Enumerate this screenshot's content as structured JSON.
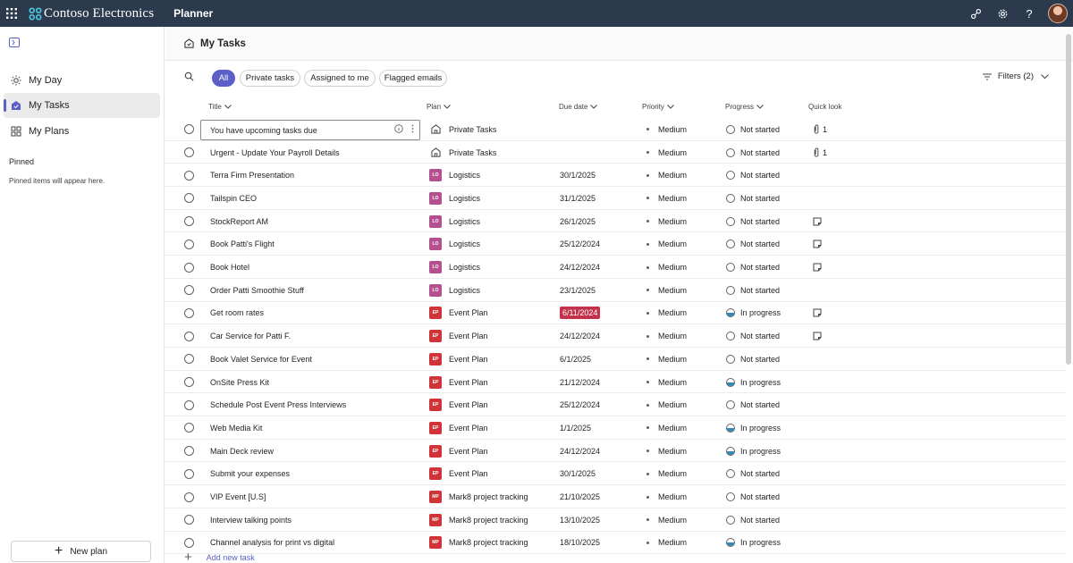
{
  "topbar": {
    "org_name": "Contoso Electronics",
    "app_name": "Planner",
    "bg_color": "#2b3a4d"
  },
  "sidebar": {
    "nav": [
      {
        "label": "My Day",
        "icon": "sun-icon"
      },
      {
        "label": "My Tasks",
        "icon": "my-tasks-icon",
        "active": true
      },
      {
        "label": "My Plans",
        "icon": "grid-icon"
      }
    ],
    "pinned_header": "Pinned",
    "pinned_empty": "Pinned items will appear here.",
    "new_plan_label": "New plan"
  },
  "header": {
    "title": "My Tasks"
  },
  "filters": {
    "pills": [
      "All",
      "Private tasks",
      "Assigned to me",
      "Flagged emails"
    ],
    "active_pill": "All",
    "filters_label": "Filters (2)"
  },
  "columns": {
    "title": "Title",
    "plan": "Plan",
    "due": "Due date",
    "priority": "Priority",
    "progress": "Progress",
    "quick_look": "Quick look"
  },
  "accent_color": "#5b5fc7",
  "plans": {
    "LO": {
      "color": "#b4508f"
    },
    "EP": {
      "color": "#d13438"
    },
    "MP": {
      "color": "#d13438"
    }
  },
  "tasks": [
    {
      "title": "You have upcoming tasks due",
      "plan": "Private Tasks",
      "plan_type": "home",
      "due": "",
      "priority": "Medium",
      "progress": "Not started",
      "quick_look": "attachment",
      "ql_count": "1",
      "selected": true
    },
    {
      "title": "Urgent - Update Your Payroll Details",
      "plan": "Private Tasks",
      "plan_type": "home",
      "due": "",
      "priority": "Medium",
      "progress": "Not started",
      "quick_look": "attachment",
      "ql_count": "1"
    },
    {
      "title": "Terra Firm Presentation",
      "plan": "Logistics",
      "plan_type": "LO",
      "due": "30/1/2025",
      "priority": "Medium",
      "progress": "Not started"
    },
    {
      "title": "Tailspin CEO",
      "plan": "Logistics",
      "plan_type": "LO",
      "due": "31/1/2025",
      "priority": "Medium",
      "progress": "Not started"
    },
    {
      "title": "StockReport AM",
      "plan": "Logistics",
      "plan_type": "LO",
      "due": "26/1/2025",
      "priority": "Medium",
      "progress": "Not started",
      "quick_look": "note"
    },
    {
      "title": "Book Patti's Flight",
      "plan": "Logistics",
      "plan_type": "LO",
      "due": "25/12/2024",
      "priority": "Medium",
      "progress": "Not started",
      "quick_look": "note"
    },
    {
      "title": "Book Hotel",
      "plan": "Logistics",
      "plan_type": "LO",
      "due": "24/12/2024",
      "priority": "Medium",
      "progress": "Not started",
      "quick_look": "note"
    },
    {
      "title": "Order Patti Smoothie Stuff",
      "plan": "Logistics",
      "plan_type": "LO",
      "due": "23/1/2025",
      "priority": "Medium",
      "progress": "Not started"
    },
    {
      "title": "Get room rates",
      "plan": "Event Plan",
      "plan_type": "EP",
      "due": "6/11/2024",
      "overdue": true,
      "priority": "Medium",
      "progress": "In progress",
      "quick_look": "note"
    },
    {
      "title": "Car Service for Patti F.",
      "plan": "Event Plan",
      "plan_type": "EP",
      "due": "24/12/2024",
      "priority": "Medium",
      "progress": "Not started",
      "quick_look": "note"
    },
    {
      "title": "Book Valet Service for Event",
      "plan": "Event Plan",
      "plan_type": "EP",
      "due": "6/1/2025",
      "priority": "Medium",
      "progress": "Not started"
    },
    {
      "title": "OnSite Press Kit",
      "plan": "Event Plan",
      "plan_type": "EP",
      "due": "21/12/2024",
      "priority": "Medium",
      "progress": "In progress"
    },
    {
      "title": "Schedule Post Event Press Interviews",
      "plan": "Event Plan",
      "plan_type": "EP",
      "due": "25/12/2024",
      "priority": "Medium",
      "progress": "Not started"
    },
    {
      "title": "Web Media Kit",
      "plan": "Event Plan",
      "plan_type": "EP",
      "due": "1/1/2025",
      "priority": "Medium",
      "progress": "In progress"
    },
    {
      "title": "Main Deck review",
      "plan": "Event Plan",
      "plan_type": "EP",
      "due": "24/12/2024",
      "priority": "Medium",
      "progress": "In progress"
    },
    {
      "title": "Submit your expenses",
      "plan": "Event Plan",
      "plan_type": "EP",
      "due": "30/1/2025",
      "priority": "Medium",
      "progress": "Not started"
    },
    {
      "title": "VIP Event [U.S]",
      "plan": "Mark8 project tracking",
      "plan_type": "MP",
      "due": "21/10/2025",
      "priority": "Medium",
      "progress": "Not started"
    },
    {
      "title": "Interview talking points",
      "plan": "Mark8 project tracking",
      "plan_type": "MP",
      "due": "13/10/2025",
      "priority": "Medium",
      "progress": "Not started"
    },
    {
      "title": "Channel analysis for print vs digital",
      "plan": "Mark8 project tracking",
      "plan_type": "MP",
      "due": "18/10/2025",
      "priority": "Medium",
      "progress": "In progress"
    }
  ],
  "add_task_label": "Add new task"
}
